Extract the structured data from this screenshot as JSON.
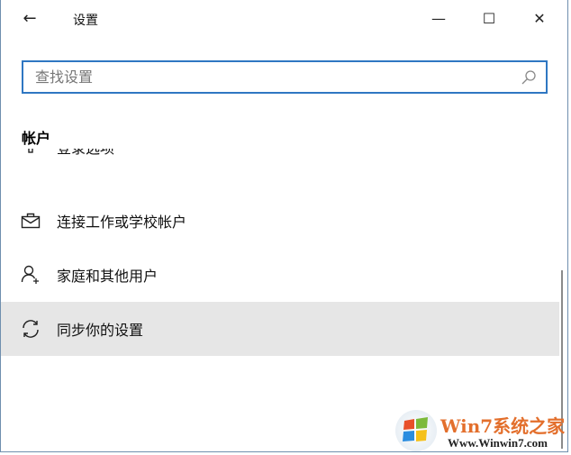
{
  "titlebar": {
    "title": "设置",
    "back": "←",
    "minimize": "—",
    "maximize": "☐",
    "close": "✕"
  },
  "search": {
    "placeholder": "查找设置",
    "value": ""
  },
  "section": {
    "heading": "帐户"
  },
  "items": [
    {
      "label": "登录选项",
      "icon": "key-icon"
    },
    {
      "label": "连接工作或学校帐户",
      "icon": "briefcase-icon"
    },
    {
      "label": "家庭和其他用户",
      "icon": "add-person-icon"
    },
    {
      "label": "同步你的设置",
      "icon": "sync-icon",
      "selected": true
    }
  ],
  "watermark": {
    "title": "Win7系统之家",
    "url": "Www.Winwin7.com"
  },
  "colors": {
    "accent": "#2f77c2",
    "selected_bg": "#e6e6e6"
  }
}
